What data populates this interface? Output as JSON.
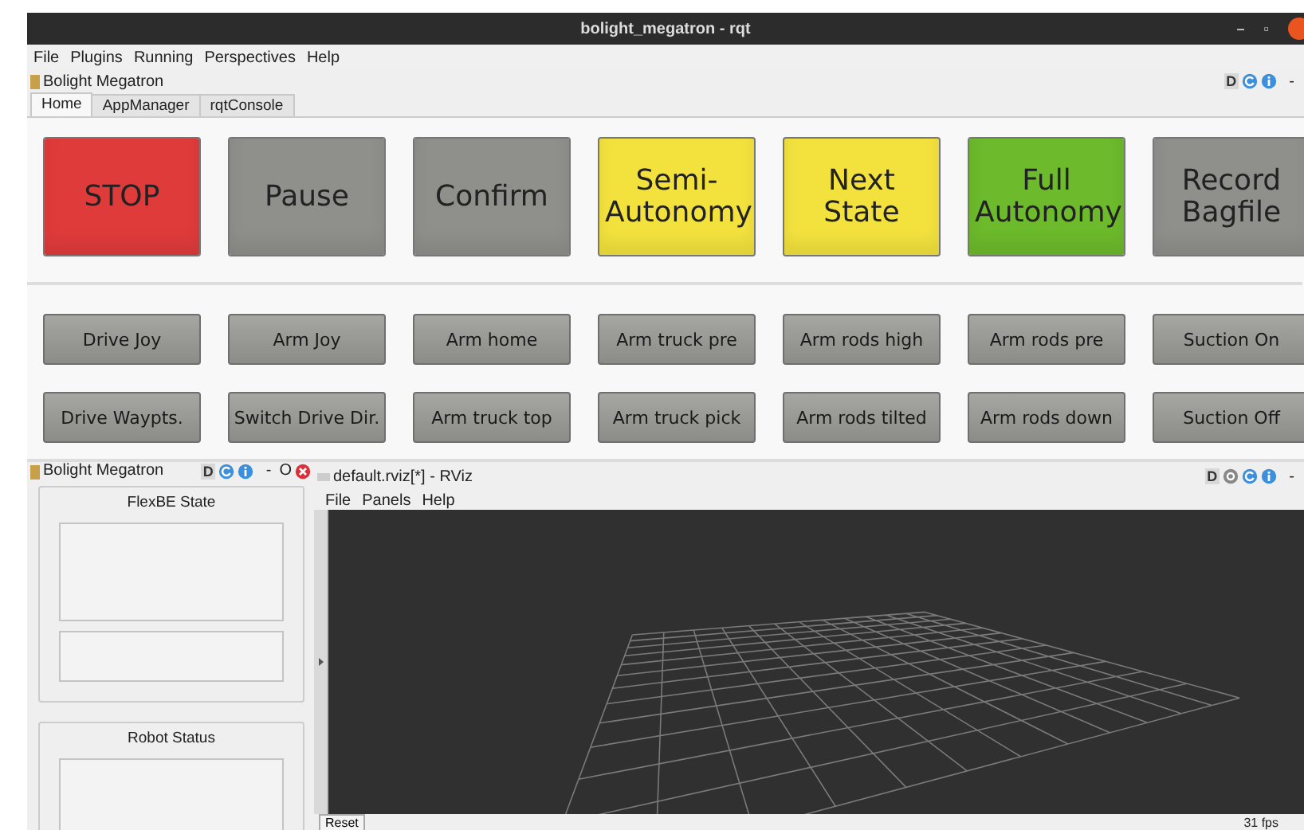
{
  "window": {
    "title": "bolight_megatron - rqt",
    "controls": [
      "–",
      "▫"
    ]
  },
  "menu": [
    "File",
    "Plugins",
    "Running",
    "Perspectives",
    "Help"
  ],
  "plugin_header": {
    "title": "Bolight Megatron",
    "badge": "D",
    "dash": "-"
  },
  "tabs": [
    {
      "label": "Home",
      "selected": true
    },
    {
      "label": "AppManager",
      "selected": false
    },
    {
      "label": "rqtConsole",
      "selected": false
    }
  ],
  "big_buttons": [
    {
      "label": "STOP",
      "color": "#e03b3b"
    },
    {
      "label": "Pause",
      "color": "#8f8f8c"
    },
    {
      "label": "Confirm",
      "color": "#8f8f8c"
    },
    {
      "label": "Semi-Autonomy",
      "color": "#f3e23e"
    },
    {
      "label": "Next State",
      "color": "#f3e23e"
    },
    {
      "label": "Full Autonomy",
      "color": "#6dba2c"
    },
    {
      "label": "Record Bagfile",
      "color": "#8f8f8c"
    }
  ],
  "small_buttons": [
    [
      "Drive Joy",
      "Arm Joy",
      "Arm home",
      "Arm truck pre",
      "Arm rods high",
      "Arm rods pre",
      "Suction On"
    ],
    [
      "Drive Waypts.",
      "Switch Drive Dir.",
      "Arm truck top",
      "Arm truck pick",
      "Arm rods tilted",
      "Arm rods down",
      "Suction Off"
    ]
  ],
  "dock": {
    "title": "Bolight Megatron",
    "badge": "D",
    "dash": "-",
    "float": "O",
    "groups": [
      {
        "title": "FlexBE State",
        "panels": [
          {
            "kind": "tall"
          },
          {
            "kind": "short"
          }
        ]
      },
      {
        "title": "Robot Status",
        "panels": [
          {
            "kind": "tall"
          }
        ]
      }
    ]
  },
  "rviz": {
    "title": "default.rviz[*] - RViz",
    "badge": "D",
    "dash": "-",
    "menu": [
      "File",
      "Panels",
      "Help"
    ],
    "reset": "Reset",
    "fps": "31 fps"
  }
}
